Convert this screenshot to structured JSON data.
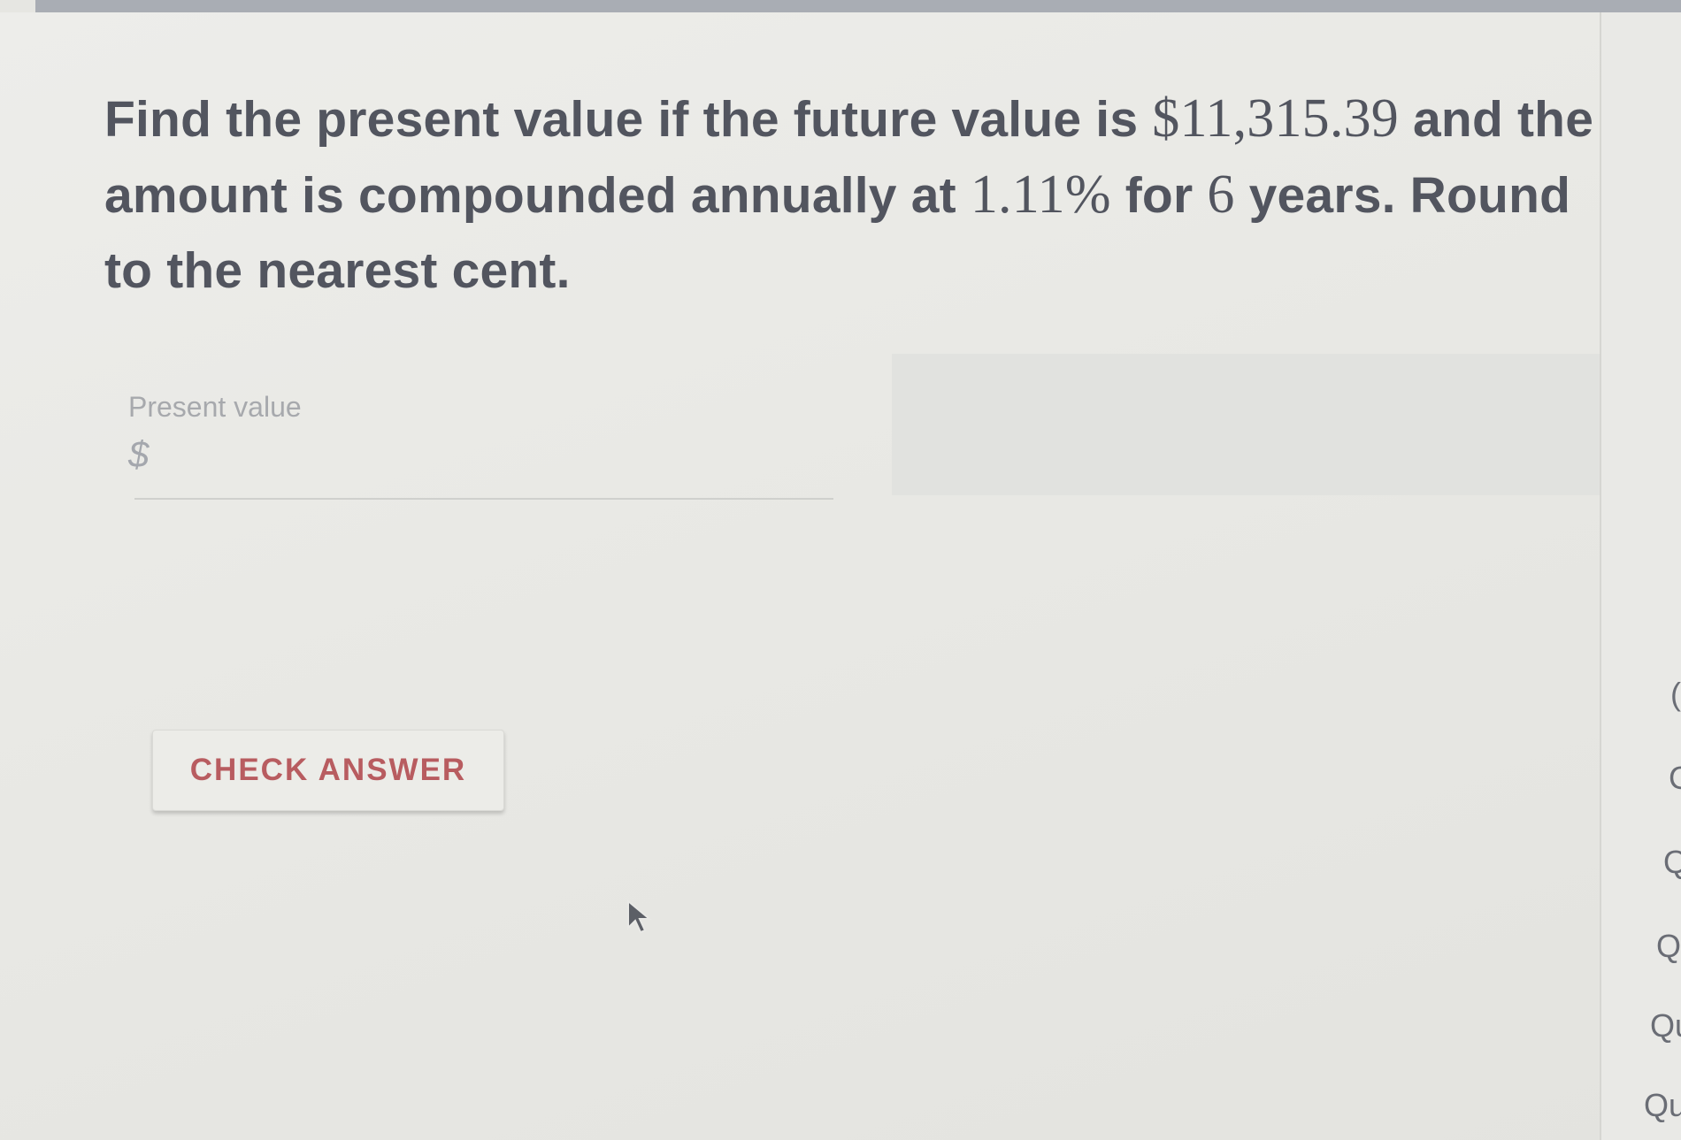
{
  "question": {
    "part1": "Find the present value if the future value is ",
    "future_value": "$11,315.39",
    "part2": " and the amount is compounded annually at ",
    "rate": "1.11%",
    "part3": " for ",
    "years": "6",
    "part4": " years. Round to the nearest cent."
  },
  "answer_field": {
    "label": "Present value",
    "currency_symbol": "$",
    "value": ""
  },
  "check_button": {
    "label": "CHECK ANSWER"
  },
  "sidebar": {
    "items": [
      "(",
      "C",
      "Q",
      "Qu",
      "Qu",
      "Qu"
    ]
  }
}
